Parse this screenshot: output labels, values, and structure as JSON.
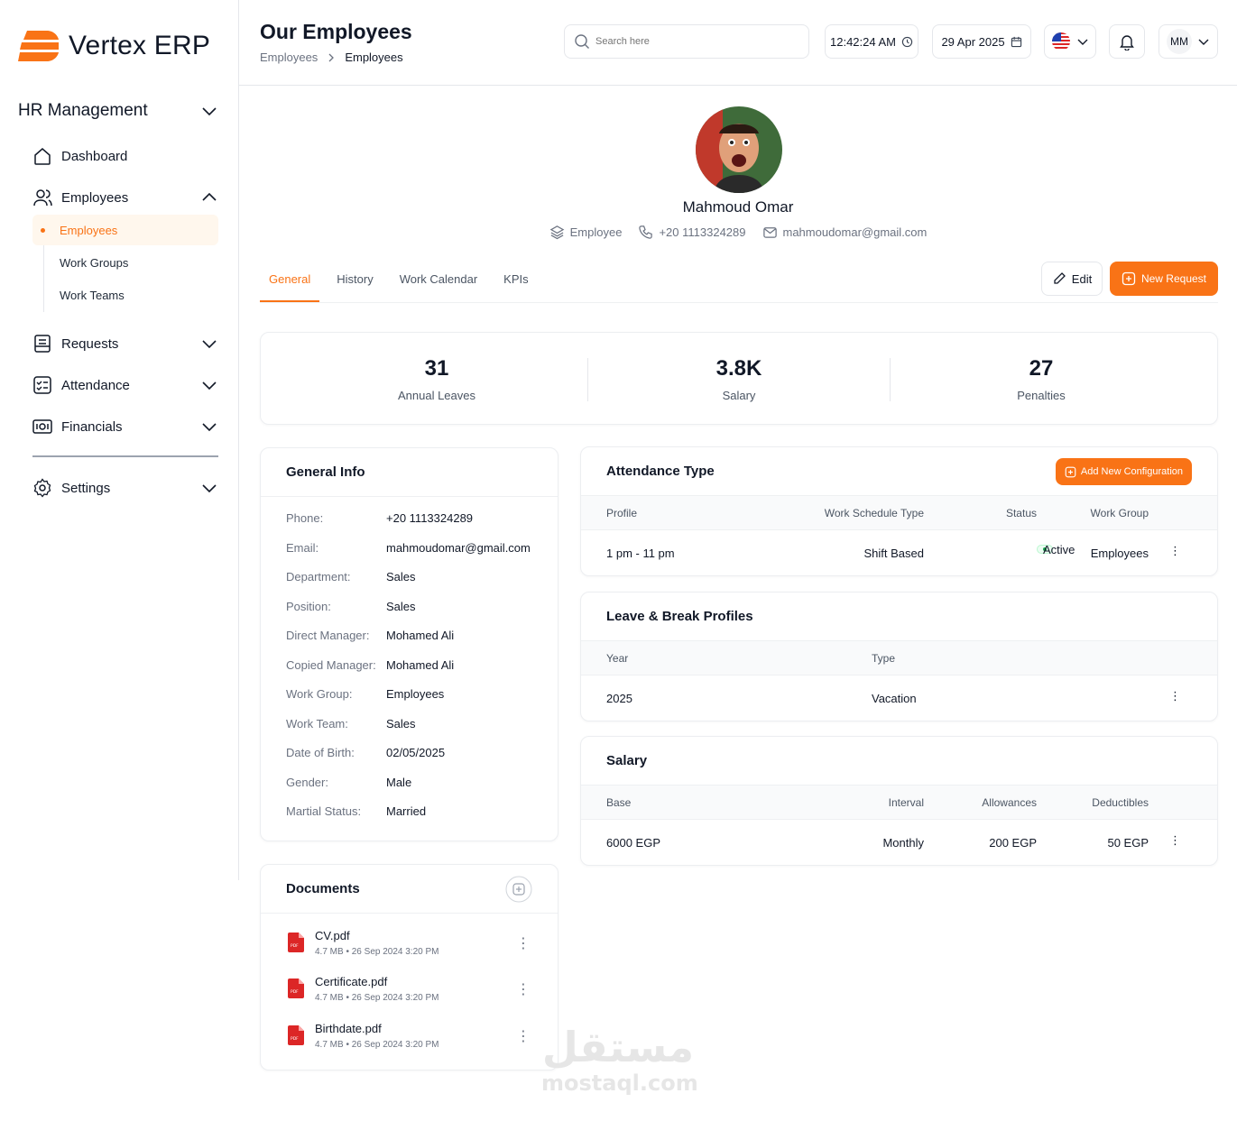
{
  "brand": {
    "name": "Vertex ERP",
    "accent": "#f97316"
  },
  "sidebar": {
    "section_title": "HR Management",
    "items": [
      {
        "label": "Dashboard"
      },
      {
        "label": "Employees"
      },
      {
        "label": "Requests"
      },
      {
        "label": "Attendance"
      },
      {
        "label": "Financials"
      },
      {
        "label": "Settings"
      }
    ],
    "sub_items": [
      {
        "label": "Employees"
      },
      {
        "label": "Work Groups"
      },
      {
        "label": "Work Teams"
      }
    ]
  },
  "header": {
    "title": "Our Employees",
    "breadcrumb": [
      "Employees",
      "Employees"
    ],
    "search_placeholder": "Search here",
    "time": "12:42:24 AM",
    "date": "29 Apr 2025",
    "user_initials": "MM"
  },
  "profile": {
    "name": "Mahmoud Omar",
    "role": "Employee",
    "phone": "+20 1113324289",
    "email": "mahmoudomar@gmail.com"
  },
  "tabs": [
    "General",
    "History",
    "Work Calendar",
    "KPIs"
  ],
  "actions": {
    "edit": "Edit",
    "new_request": "New Request"
  },
  "stats": [
    {
      "value": "31",
      "label": "Annual Leaves"
    },
    {
      "value": "3.8K",
      "label": "Salary"
    },
    {
      "value": "27",
      "label": "Penalties"
    }
  ],
  "general_info": {
    "title": "General Info",
    "rows": [
      {
        "k": "Phone:",
        "v": "+20 1113324289"
      },
      {
        "k": "Email:",
        "v": "mahmoudomar@gmail.com"
      },
      {
        "k": "Department:",
        "v": "Sales"
      },
      {
        "k": "Position:",
        "v": "Sales"
      },
      {
        "k": "Direct Manager:",
        "v": "Mohamed Ali"
      },
      {
        "k": "Copied Manager:",
        "v": "Mohamed Ali"
      },
      {
        "k": "Work Group:",
        "v": "Employees"
      },
      {
        "k": "Work Team:",
        "v": "Sales"
      },
      {
        "k": "Date of Birth:",
        "v": "02/05/2025"
      },
      {
        "k": "Gender:",
        "v": "Male"
      },
      {
        "k": "Martial Status:",
        "v": "Married"
      }
    ]
  },
  "documents": {
    "title": "Documents",
    "files": [
      {
        "name": "CV.pdf",
        "size": "4.7 MB",
        "date": "26 Sep 2024 3:20 PM"
      },
      {
        "name": "Certificate.pdf",
        "size": "4.7 MB",
        "date": "26 Sep 2024 3:20 PM"
      },
      {
        "name": "Birthdate.pdf",
        "size": "4.7 MB",
        "date": "26 Sep 2024 3:20 PM"
      }
    ]
  },
  "attendance": {
    "title": "Attendance Type",
    "add_button": "Add New Configuration",
    "columns": [
      "Profile",
      "Work Schedule Type",
      "Status",
      "Work Group"
    ],
    "row": {
      "profile": "1 pm - 11 pm",
      "schedule": "Shift Based",
      "status": "Active",
      "group": "Employees"
    }
  },
  "leave": {
    "title": "Leave & Break Profiles",
    "columns": [
      "Year",
      "Type"
    ],
    "row": {
      "year": "2025",
      "type": "Vacation"
    }
  },
  "salary": {
    "title": "Salary",
    "columns": [
      "Base",
      "Interval",
      "Allowances",
      "Deductibles"
    ],
    "row": {
      "base": "6000 EGP",
      "interval": "Monthly",
      "allowances": "200 EGP",
      "deductibles": "50 EGP"
    }
  },
  "watermark": {
    "arabic": "مستقل",
    "latin": "mostaql.com"
  }
}
